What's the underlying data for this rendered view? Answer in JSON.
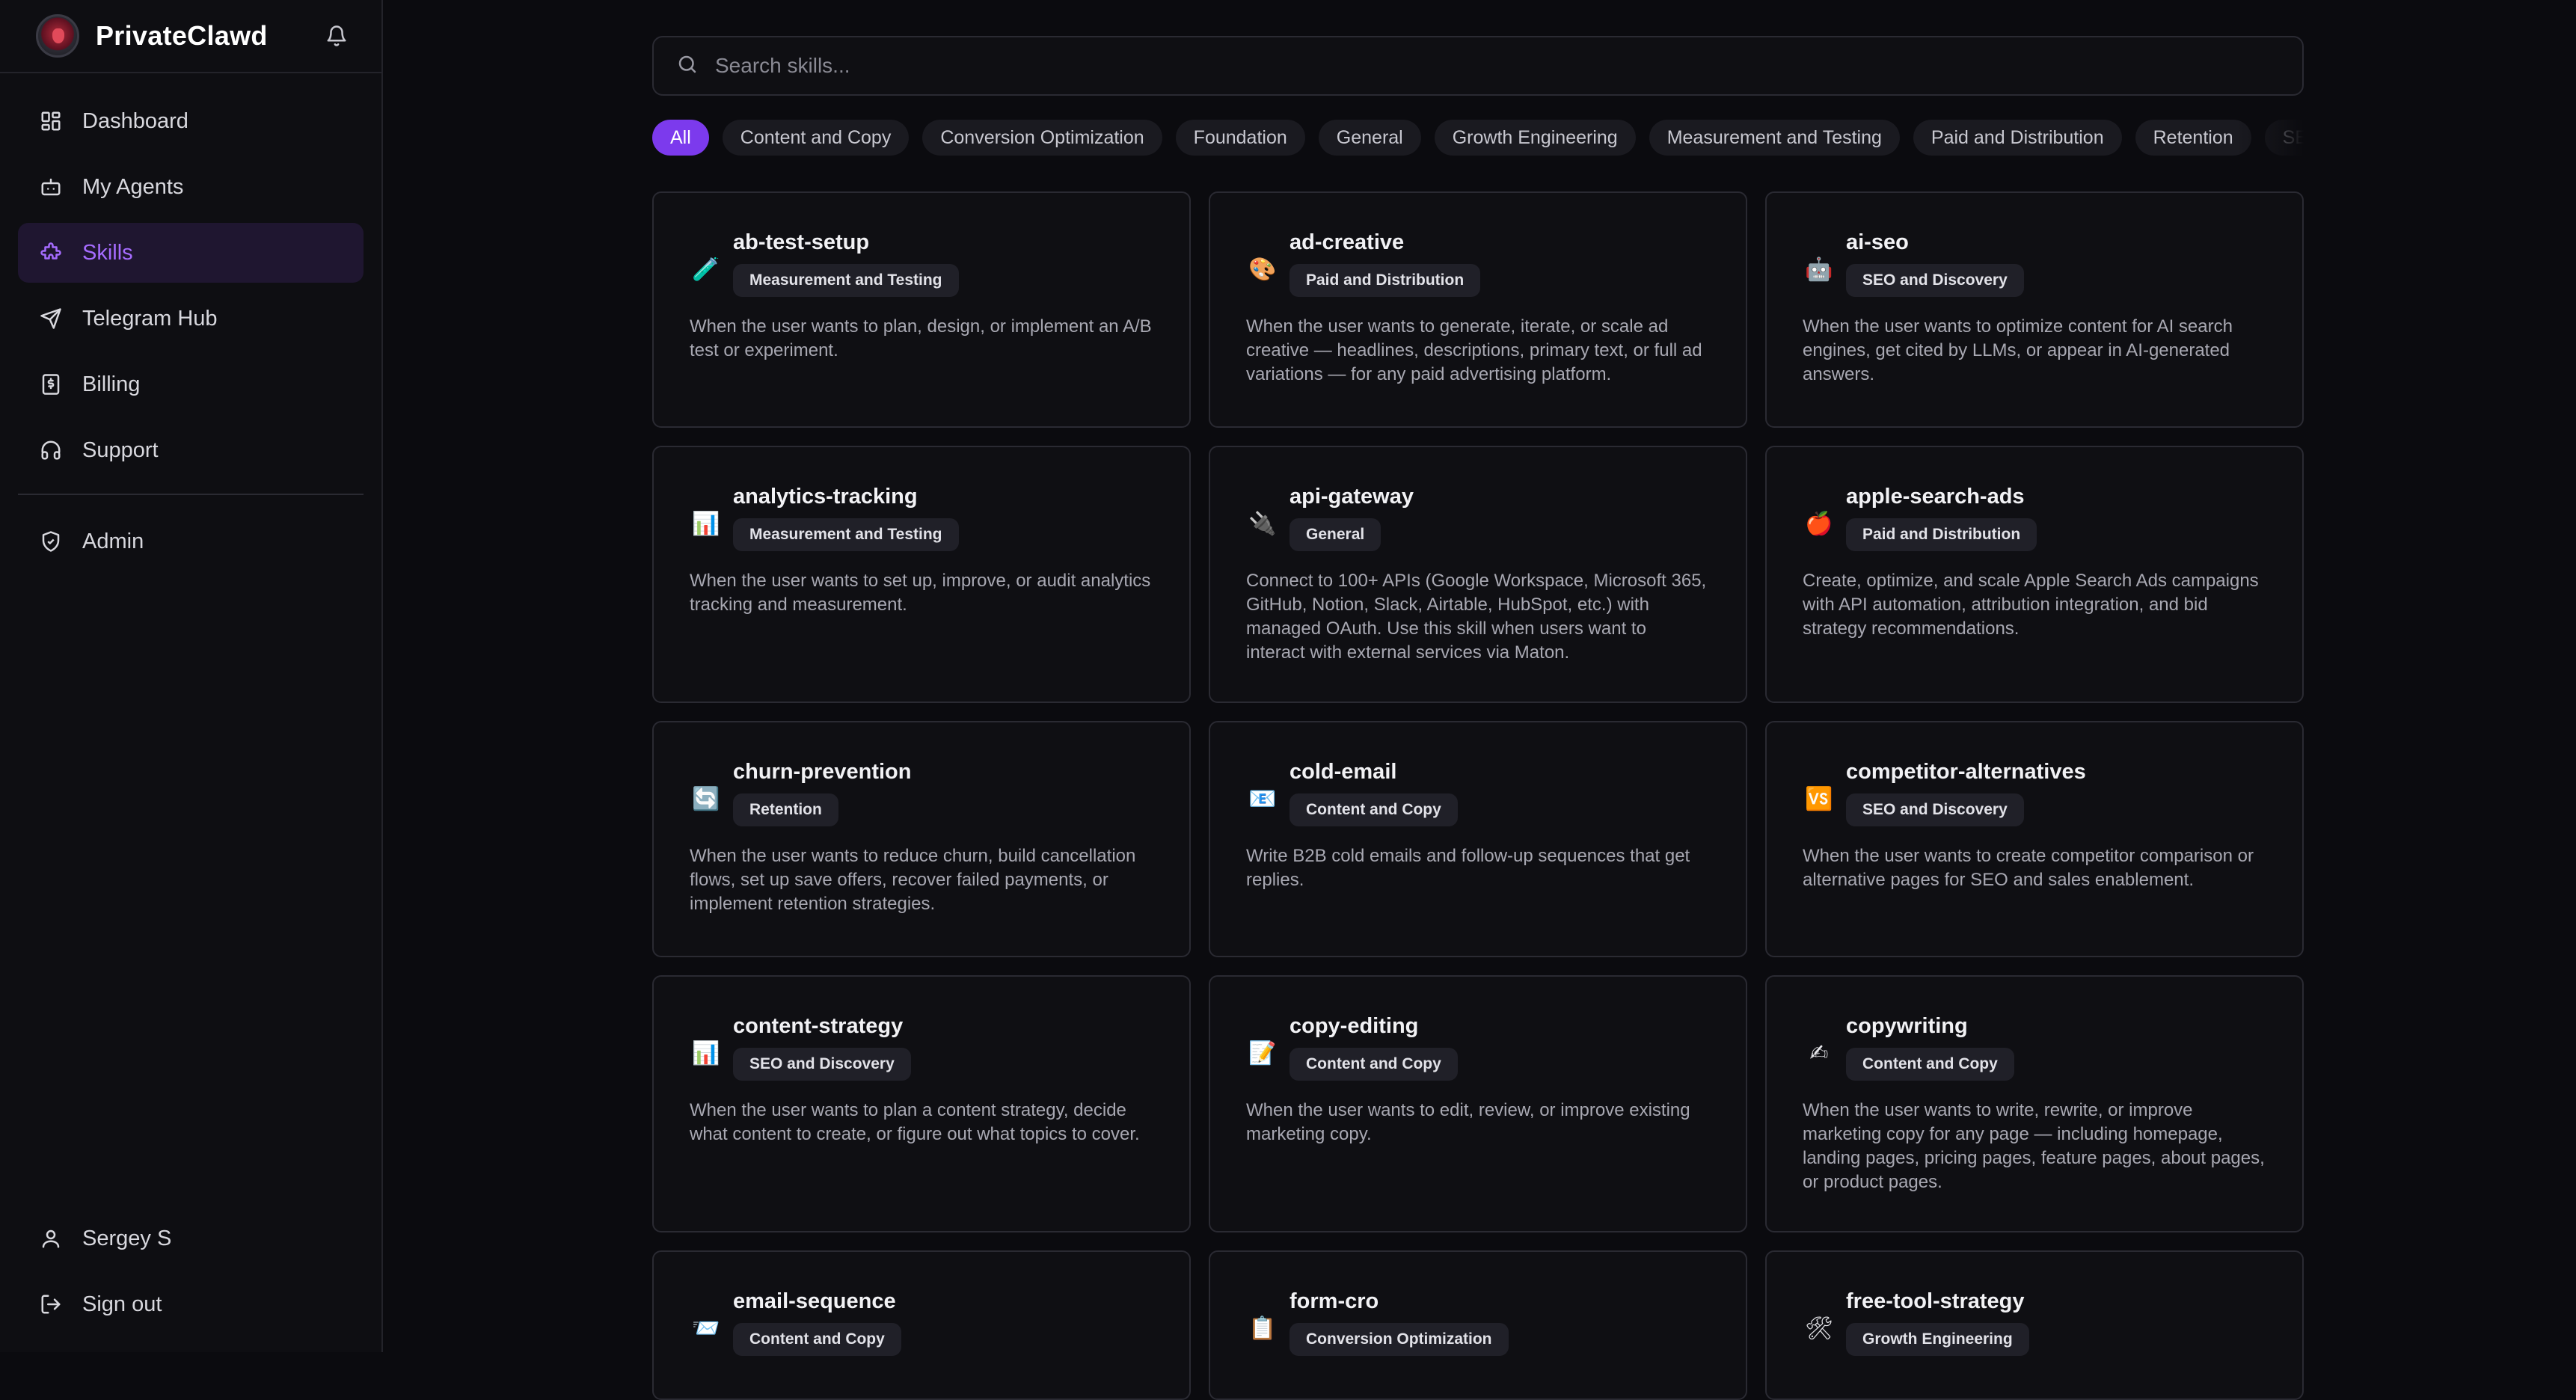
{
  "app": {
    "name": "PrivateClawd"
  },
  "nav": {
    "items": [
      {
        "label": "Dashboard",
        "icon": "dashboard-icon"
      },
      {
        "label": "My Agents",
        "icon": "bot-icon"
      },
      {
        "label": "Skills",
        "icon": "puzzle-icon",
        "active": true
      },
      {
        "label": "Telegram Hub",
        "icon": "send-icon"
      },
      {
        "label": "Billing",
        "icon": "receipt-icon"
      },
      {
        "label": "Support",
        "icon": "headset-icon"
      }
    ],
    "admin": {
      "label": "Admin",
      "icon": "shield-icon"
    }
  },
  "user": {
    "name": "Sergey S",
    "signout": "Sign out"
  },
  "search": {
    "placeholder": "Search skills..."
  },
  "filters": [
    "All",
    "Content and Copy",
    "Conversion Optimization",
    "Foundation",
    "General",
    "Growth Engineering",
    "Measurement and Testing",
    "Paid and Distribution",
    "Retention",
    "SEO"
  ],
  "colors": {
    "accent": "#7c3aed",
    "accent_text": "#a66cff",
    "background": "#0b0b0f"
  },
  "skills": [
    {
      "name": "ab-test-setup",
      "category": "Measurement and Testing",
      "icon": "test-tube-icon",
      "glyph": "🧪",
      "desc": "When the user wants to plan, design, or implement an A/B test or experiment."
    },
    {
      "name": "ad-creative",
      "category": "Paid and Distribution",
      "icon": "palette-icon",
      "glyph": "🎨",
      "desc": "When the user wants to generate, iterate, or scale ad creative — headlines, descriptions, primary text, or full ad variations — for any paid advertising platform."
    },
    {
      "name": "ai-seo",
      "category": "SEO and Discovery",
      "icon": "robot-icon",
      "glyph": "🤖",
      "desc": "When the user wants to optimize content for AI search engines, get cited by LLMs, or appear in AI-generated answers."
    },
    {
      "name": "analytics-tracking",
      "category": "Measurement and Testing",
      "icon": "bar-chart-icon",
      "glyph": "📊",
      "desc": "When the user wants to set up, improve, or audit analytics tracking and measurement."
    },
    {
      "name": "api-gateway",
      "category": "General",
      "icon": "plug-icon",
      "glyph": "🔌",
      "desc": "Connect to 100+ APIs (Google Workspace, Microsoft 365, GitHub, Notion, Slack, Airtable, HubSpot, etc.) with managed OAuth. Use this skill when users want to interact with external services via Maton."
    },
    {
      "name": "apple-search-ads",
      "category": "Paid and Distribution",
      "icon": "apple-icon",
      "glyph": "🍎",
      "desc": "Create, optimize, and scale Apple Search Ads campaigns with API automation, attribution integration, and bid strategy recommendations."
    },
    {
      "name": "churn-prevention",
      "category": "Retention",
      "icon": "refresh-icon",
      "glyph": "🔄",
      "desc": "When the user wants to reduce churn, build cancellation flows, set up save offers, recover failed payments, or implement retention strategies."
    },
    {
      "name": "cold-email",
      "category": "Content and Copy",
      "icon": "envelope-icon",
      "glyph": "📧",
      "desc": "Write B2B cold emails and follow-up sequences that get replies."
    },
    {
      "name": "competitor-alternatives",
      "category": "SEO and Discovery",
      "icon": "vs-icon",
      "glyph": "🆚",
      "desc": "When the user wants to create competitor comparison or alternative pages for SEO and sales enablement."
    },
    {
      "name": "content-strategy",
      "category": "SEO and Discovery",
      "icon": "bar-chart-icon",
      "glyph": "📊",
      "desc": "When the user wants to plan a content strategy, decide what content to create, or figure out what topics to cover."
    },
    {
      "name": "copy-editing",
      "category": "Content and Copy",
      "icon": "memo-icon",
      "glyph": "📝",
      "desc": "When the user wants to edit, review, or improve existing marketing copy."
    },
    {
      "name": "copywriting",
      "category": "Content and Copy",
      "icon": "writing-hand-icon",
      "glyph": "✍",
      "desc": "When the user wants to write, rewrite, or improve marketing copy for any page — including homepage, landing pages, pricing pages, feature pages, about pages, or product pages."
    },
    {
      "name": "email-sequence",
      "category": "Content and Copy",
      "icon": "envelope-icon",
      "glyph": "📨",
      "desc": ""
    },
    {
      "name": "form-cro",
      "category": "Conversion Optimization",
      "icon": "clipboard-icon",
      "glyph": "📋",
      "desc": ""
    },
    {
      "name": "free-tool-strategy",
      "category": "Growth Engineering",
      "icon": "tools-icon",
      "glyph": "🛠",
      "desc": ""
    }
  ]
}
